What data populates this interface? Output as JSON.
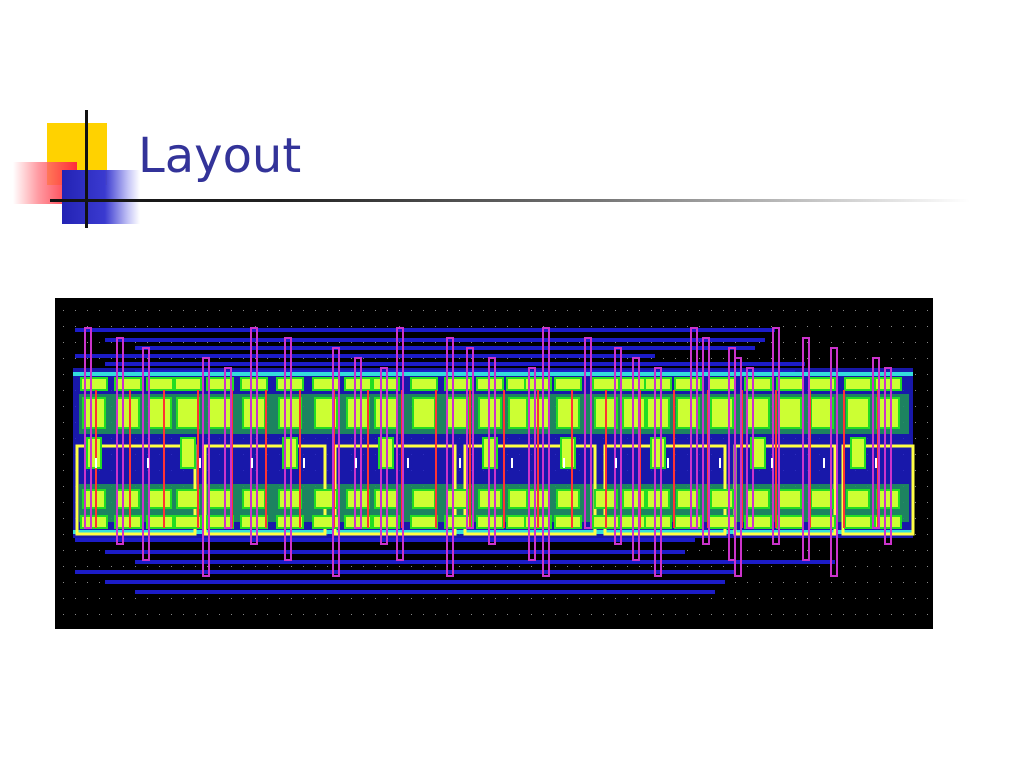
{
  "slide": {
    "title": "Layout"
  },
  "figure": {
    "description_icon": "vlsi-layout-image",
    "colors": {
      "background": "#000000",
      "metal1": "#1c1cc8",
      "metal2": "#cc33cc",
      "diffusion": "#22dd22",
      "active_fill": "#ccff33",
      "well_outline": "#ffff44",
      "rail": "#33dddd",
      "poly": "#ff3333"
    }
  },
  "theme": {
    "title_color": "#333399",
    "ornament_yellow": "#ffd200",
    "ornament_red": "#ff2a3a",
    "ornament_blue": "#2323b4"
  }
}
